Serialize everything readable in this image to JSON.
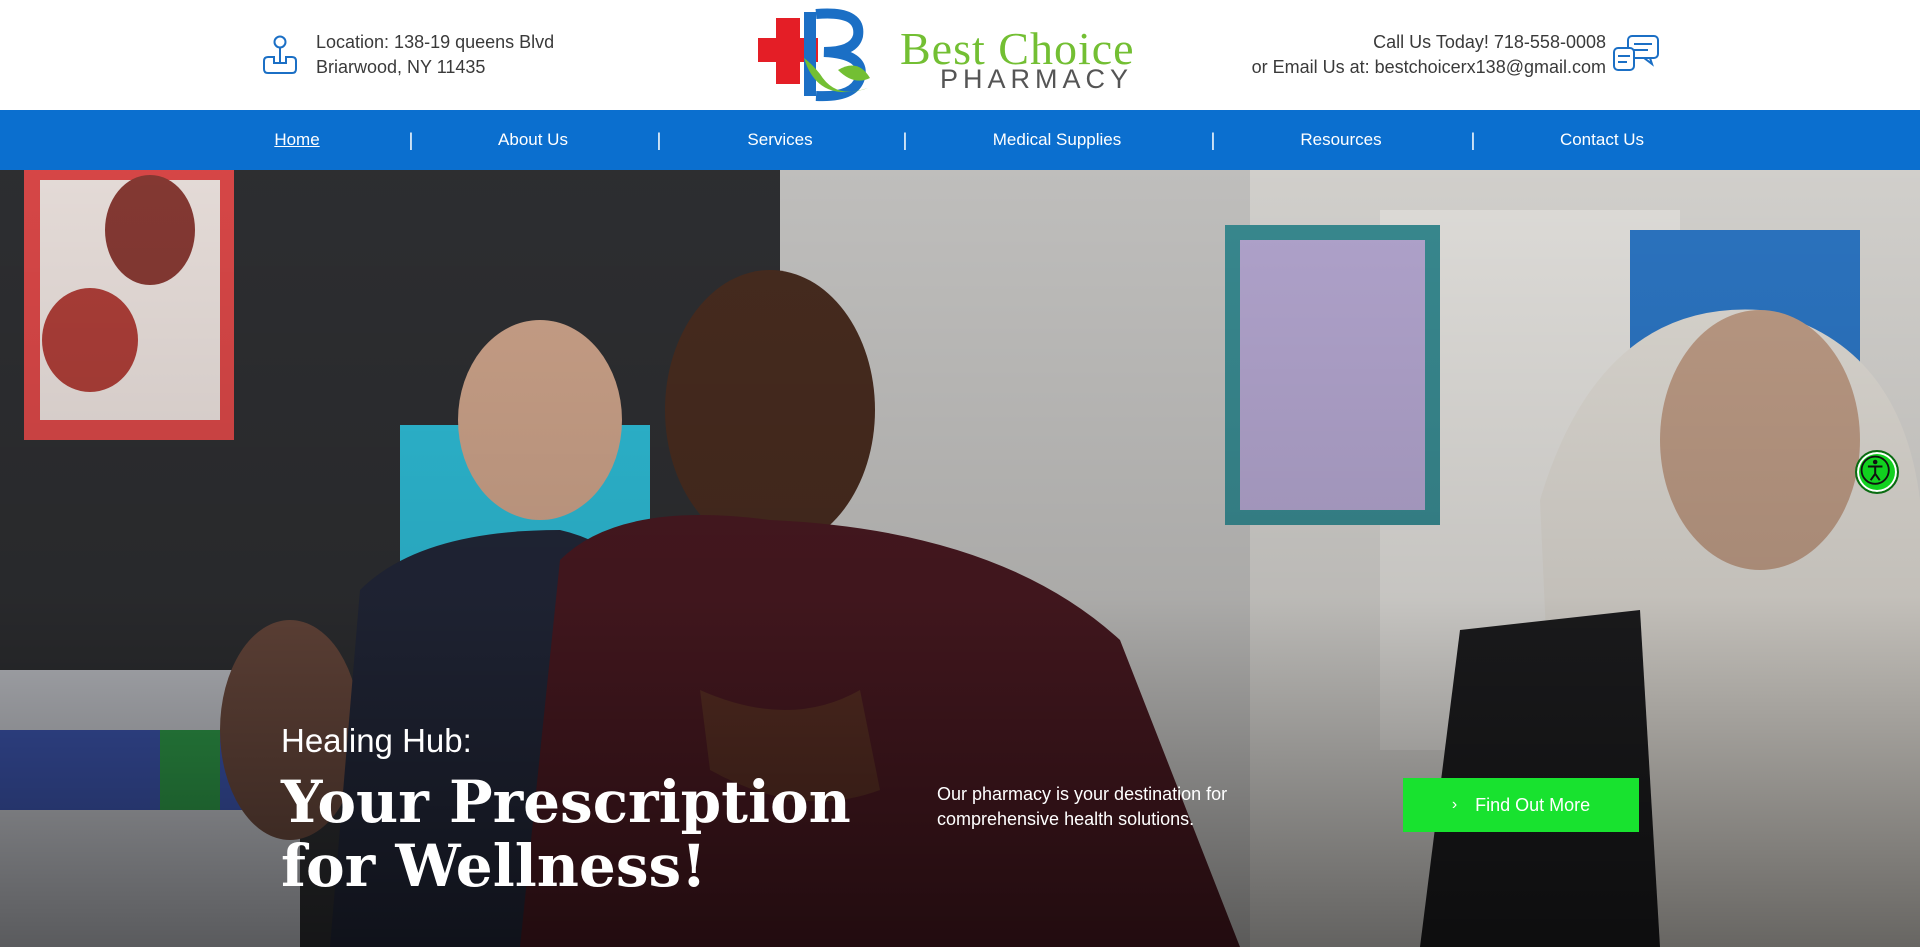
{
  "header": {
    "location_line1": "Location: 138-19 queens Blvd",
    "location_line2": "Briarwood, NY 11435",
    "logo_text_main": "Best Choice",
    "logo_text_sub": "PHARMACY",
    "contact_line1": "Call Us Today! 718-558-0008",
    "contact_line2": "or Email Us at: bestchoicerx138@gmail.com"
  },
  "nav": {
    "items": [
      {
        "label": "Home",
        "active": true
      },
      {
        "label": "About Us"
      },
      {
        "label": "Services"
      },
      {
        "label": "Medical Supplies"
      },
      {
        "label": "Resources"
      },
      {
        "label": "Contact Us"
      }
    ],
    "separator": "|"
  },
  "hero": {
    "eyebrow": "Healing Hub:",
    "headline_line1": "Your Prescription",
    "headline_line2": "for Wellness!",
    "blurb_line1": "Our pharmacy is your destination for",
    "blurb_line2": "comprehensive health solutions.",
    "cta_label": "Find Out More"
  },
  "colors": {
    "nav_bg": "#0b6fcf",
    "cta_bg": "#18e22f",
    "logo_green": "#73bf33",
    "logo_red": "#e41e26",
    "logo_blue": "#1b6fc5"
  },
  "icons": [
    "location-pin-icon",
    "chat-bubbles-icon",
    "chevron-right-icon",
    "accessibility-icon"
  ]
}
